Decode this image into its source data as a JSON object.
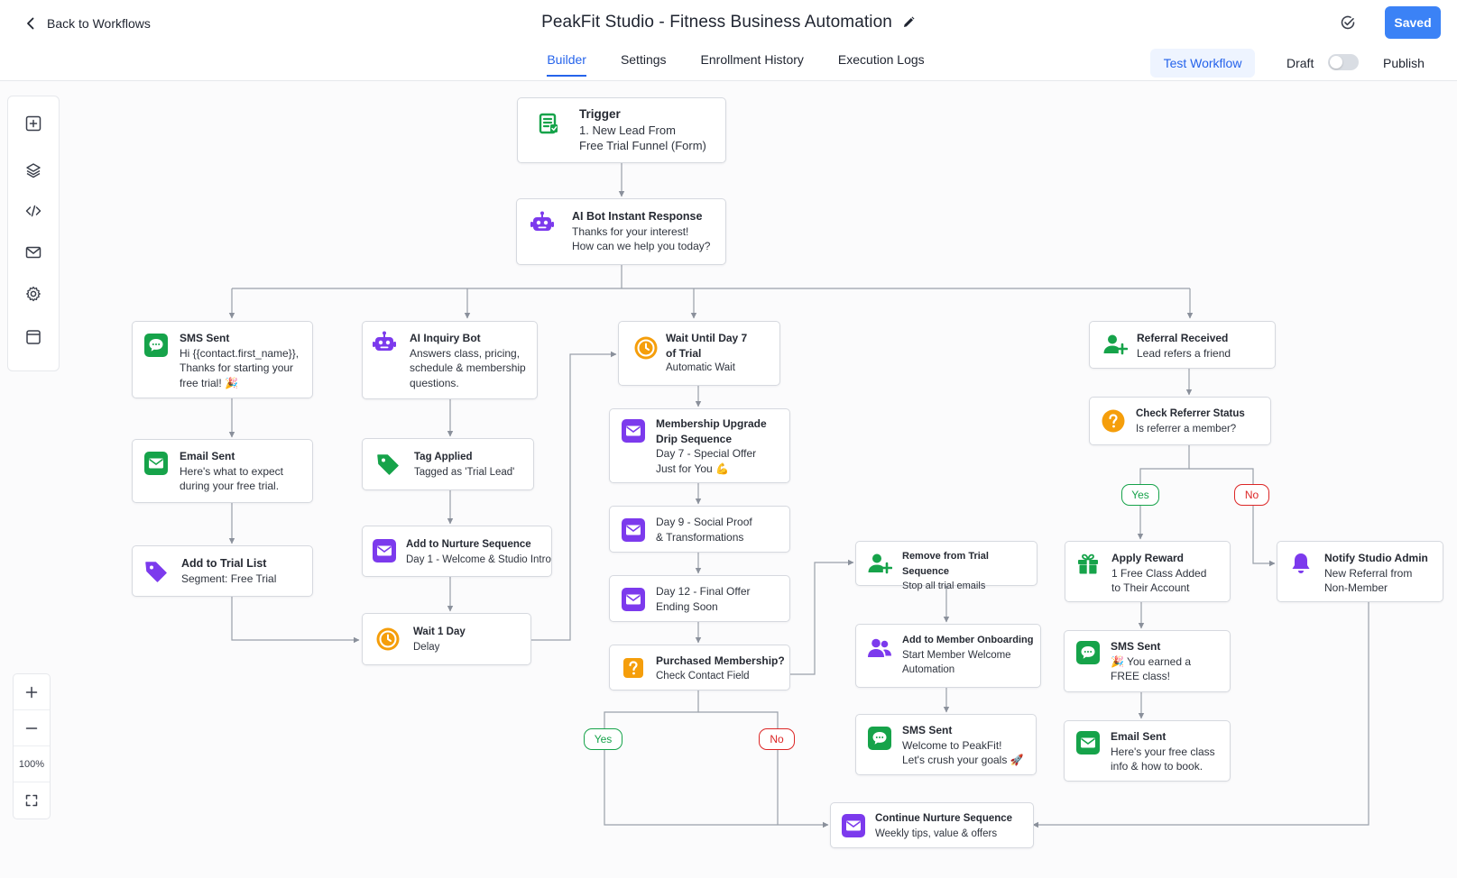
{
  "header": {
    "back_label": "Back to Workflows",
    "title": "PeakFit Studio - Fitness Business Automation",
    "saved_label": "Saved",
    "test_workflow_label": "Test Workflow",
    "draft_label": "Draft",
    "publish_label": "Publish",
    "publish_toggle_on": false
  },
  "tabs": [
    {
      "label": "Builder",
      "active": true
    },
    {
      "label": "Settings",
      "active": false
    },
    {
      "label": "Enrollment History",
      "active": false
    },
    {
      "label": "Execution Logs",
      "active": false
    }
  ],
  "side_tools": [
    "plus-square-icon",
    "layers-icon",
    "code-icon",
    "mail-icon",
    "gear-icon",
    "panel-icon"
  ],
  "zoom": {
    "level": "100%"
  },
  "nodes": {
    "trigger": {
      "title": "Trigger",
      "desc": "1. New Lead From\nFree Trial Funnel (Form)"
    },
    "ai_response": {
      "title": "AI Bot Instant Response",
      "desc": "Thanks for your interest!\nHow can we help you today?"
    },
    "sms_sent_1": {
      "title": "SMS Sent",
      "desc": "Hi {{contact.first_name}},\nThanks for starting your\nfree trial! 🎉"
    },
    "email_sent_1": {
      "title": "Email Sent",
      "desc": "Here's what to expect\nduring your free trial."
    },
    "add_trial_list": {
      "title": "Add to Trial List",
      "desc": "Segment: Free Trial"
    },
    "ai_inquiry": {
      "title": "AI Inquiry Bot",
      "desc": "Answers class, pricing,\nschedule & membership\nquestions."
    },
    "tag_applied": {
      "title": "Tag Applied",
      "desc": "Tagged as 'Trial Lead'"
    },
    "add_nurture": {
      "title": "Add to Nurture Sequence",
      "desc": "Day 1 - Welcome & Studio Intro"
    },
    "wait_1_day": {
      "title": "Wait 1 Day",
      "desc": "Delay"
    },
    "wait_day_7": {
      "title": "Wait Until Day 7\nof Trial",
      "desc": "Automatic Wait"
    },
    "upgrade_drip": {
      "title": "Membership Upgrade\nDrip Sequence",
      "desc": "Day 7 - Special Offer\nJust for You 💪"
    },
    "day_9": {
      "title": "",
      "desc": "Day 9 - Social Proof\n& Transformations"
    },
    "day_12": {
      "title": "",
      "desc": "Day 12 - Final Offer\nEnding Soon"
    },
    "purchased": {
      "title": "Purchased Membership?",
      "desc": "Check Contact Field"
    },
    "remove_trial": {
      "title": "Remove from Trial Sequence",
      "desc": "Stop all trial emails"
    },
    "member_onboarding": {
      "title": "Add to Member Onboarding",
      "desc": "Start Member Welcome\nAutomation"
    },
    "sms_sent_2": {
      "title": "SMS Sent",
      "desc": "Welcome to PeakFit!\nLet's crush your goals 🚀"
    },
    "continue_nurture": {
      "title": "Continue Nurture Sequence",
      "desc": "Weekly tips, value & offers"
    },
    "referral_received": {
      "title": "Referral Received",
      "desc": "Lead refers a friend"
    },
    "check_referrer": {
      "title": "Check Referrer Status",
      "desc": "Is referrer a member?"
    },
    "apply_reward": {
      "title": "Apply Reward",
      "desc": "1 Free Class Added\nto Their Account"
    },
    "notify_admin": {
      "title": "Notify Studio Admin",
      "desc": "New Referral from\nNon-Member"
    },
    "sms_sent_3": {
      "title": "SMS Sent",
      "desc": "🎉 You earned a\nFREE class!"
    },
    "email_sent_2": {
      "title": "Email Sent",
      "desc": "Here's your free class\ninfo & how to book."
    }
  },
  "branches": {
    "purchase_yes": "Yes",
    "purchase_no": "No",
    "referrer_yes": "Yes",
    "referrer_no": "No"
  },
  "colors": {
    "primary": "#3b82f6",
    "green": "#16a34a",
    "purple": "#7c3aed",
    "orange": "#f59e0b",
    "red": "#dc2626",
    "connector": "#9aa0aa"
  }
}
